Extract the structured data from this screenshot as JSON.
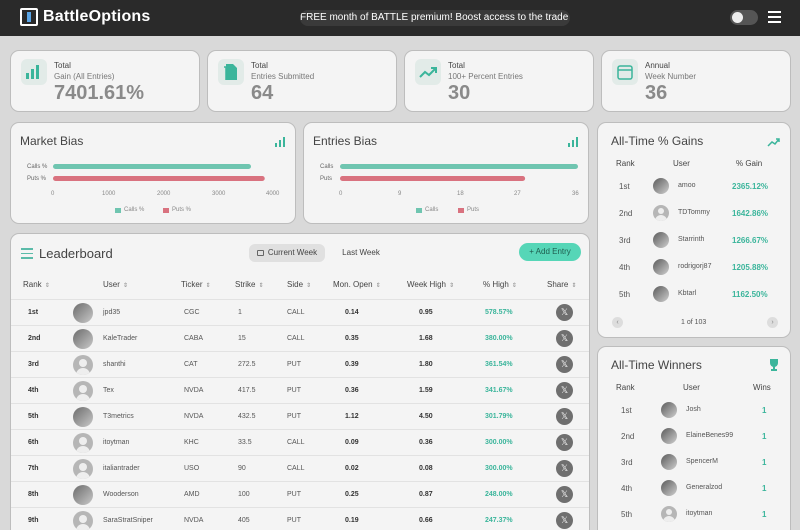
{
  "app": {
    "name": "BattleOptions",
    "promo": "FREE month of BATTLE premium! Boost access to the trade alerts tab"
  },
  "colors": {
    "accent": "#3bb59b",
    "calls": "#6fc5b0",
    "puts": "#d9727f"
  },
  "stats": [
    {
      "icon": "bar-chart-icon",
      "line1": "Total",
      "line2": "Gain (All Entries)",
      "value": "7401.61%"
    },
    {
      "icon": "documents-icon",
      "line1": "Total",
      "line2": "Entries Submitted",
      "value": "64"
    },
    {
      "icon": "trend-up-icon",
      "line1": "Total",
      "line2": "100+ Percent Entries",
      "value": "30"
    },
    {
      "icon": "calendar-icon",
      "line1": "Annual",
      "line2": "Week Number",
      "value": "36"
    }
  ],
  "market_bias": {
    "title": "Market Bias",
    "labels": [
      "Calls %",
      "Puts %"
    ],
    "ticks": [
      "0",
      "1000",
      "2000",
      "3000",
      "4000"
    ],
    "legend": [
      "Calls %",
      "Puts %"
    ],
    "chart_data": {
      "type": "bar",
      "orientation": "horizontal",
      "categories": [
        "Calls %",
        "Puts %"
      ],
      "values": [
        3600,
        3850
      ],
      "xlim": [
        0,
        4000
      ]
    }
  },
  "entries_bias": {
    "title": "Entries Bias",
    "labels": [
      "Calls",
      "Puts"
    ],
    "ticks": [
      "0",
      "9",
      "18",
      "27",
      "36"
    ],
    "legend": [
      "Calls",
      "Puts"
    ],
    "chart_data": {
      "type": "bar",
      "orientation": "horizontal",
      "categories": [
        "Calls",
        "Puts"
      ],
      "values": [
        36,
        28
      ],
      "xlim": [
        0,
        36
      ]
    }
  },
  "leaderboard": {
    "title": "Leaderboard",
    "tabs": [
      "Current Week",
      "Last Week"
    ],
    "add_label": "Add Entry",
    "columns": [
      "Rank",
      "User",
      "Ticker",
      "Strike",
      "Side",
      "Mon. Open",
      "Week High",
      "% High",
      "Share"
    ],
    "rows": [
      {
        "rank": "1st",
        "user": "jpd35",
        "ticker": "CGC",
        "strike": "1",
        "side": "CALL",
        "open": "0.14",
        "high": "0.95",
        "pct": "578.57%",
        "avatar": "photo"
      },
      {
        "rank": "2nd",
        "user": "KaleTrader",
        "ticker": "CABA",
        "strike": "15",
        "side": "CALL",
        "open": "0.35",
        "high": "1.68",
        "pct": "380.00%",
        "avatar": "photo"
      },
      {
        "rank": "3rd",
        "user": "shanthi",
        "ticker": "CAT",
        "strike": "272.5",
        "side": "PUT",
        "open": "0.39",
        "high": "1.80",
        "pct": "361.54%",
        "avatar": "default"
      },
      {
        "rank": "4th",
        "user": "Tex",
        "ticker": "NVDA",
        "strike": "417.5",
        "side": "PUT",
        "open": "0.36",
        "high": "1.59",
        "pct": "341.67%",
        "avatar": "default"
      },
      {
        "rank": "5th",
        "user": "T3metrics",
        "ticker": "NVDA",
        "strike": "432.5",
        "side": "PUT",
        "open": "1.12",
        "high": "4.50",
        "pct": "301.79%",
        "avatar": "photo"
      },
      {
        "rank": "6th",
        "user": "itoytman",
        "ticker": "KHC",
        "strike": "33.5",
        "side": "CALL",
        "open": "0.09",
        "high": "0.36",
        "pct": "300.00%",
        "avatar": "default"
      },
      {
        "rank": "7th",
        "user": "italiantrader",
        "ticker": "USO",
        "strike": "90",
        "side": "CALL",
        "open": "0.02",
        "high": "0.08",
        "pct": "300.00%",
        "avatar": "default"
      },
      {
        "rank": "8th",
        "user": "Wooderson",
        "ticker": "AMD",
        "strike": "100",
        "side": "PUT",
        "open": "0.25",
        "high": "0.87",
        "pct": "248.00%",
        "avatar": "photo"
      },
      {
        "rank": "9th",
        "user": "SaraStratSniper",
        "ticker": "NVDA",
        "strike": "405",
        "side": "PUT",
        "open": "0.19",
        "high": "0.66",
        "pct": "247.37%",
        "avatar": "default"
      }
    ]
  },
  "gains": {
    "title": "All-Time % Gains",
    "columns": [
      "Rank",
      "User",
      "% Gain"
    ],
    "rows": [
      {
        "rank": "1st",
        "user": "amoo",
        "value": "2365.12%",
        "avatar": "photo"
      },
      {
        "rank": "2nd",
        "user": "TDTommy",
        "value": "1642.86%",
        "avatar": "default"
      },
      {
        "rank": "3rd",
        "user": "Starrinth",
        "value": "1266.67%",
        "avatar": "photo"
      },
      {
        "rank": "4th",
        "user": "rodrigorj87",
        "value": "1205.88%",
        "avatar": "photo"
      },
      {
        "rank": "5th",
        "user": "Kbtarl",
        "value": "1162.50%",
        "avatar": "photo"
      }
    ],
    "pager": "1 of 103"
  },
  "winners": {
    "title": "All-Time Winners",
    "columns": [
      "Rank",
      "User",
      "Wins"
    ],
    "rows": [
      {
        "rank": "1st",
        "user": "Josh",
        "value": "1",
        "avatar": "photo"
      },
      {
        "rank": "2nd",
        "user": "ElaineBenes99",
        "value": "1",
        "avatar": "photo"
      },
      {
        "rank": "3rd",
        "user": "SpencerM",
        "value": "1",
        "avatar": "photo"
      },
      {
        "rank": "4th",
        "user": "Generalzod",
        "value": "1",
        "avatar": "photo"
      },
      {
        "rank": "5th",
        "user": "itoytman",
        "value": "1",
        "avatar": "default"
      }
    ]
  }
}
